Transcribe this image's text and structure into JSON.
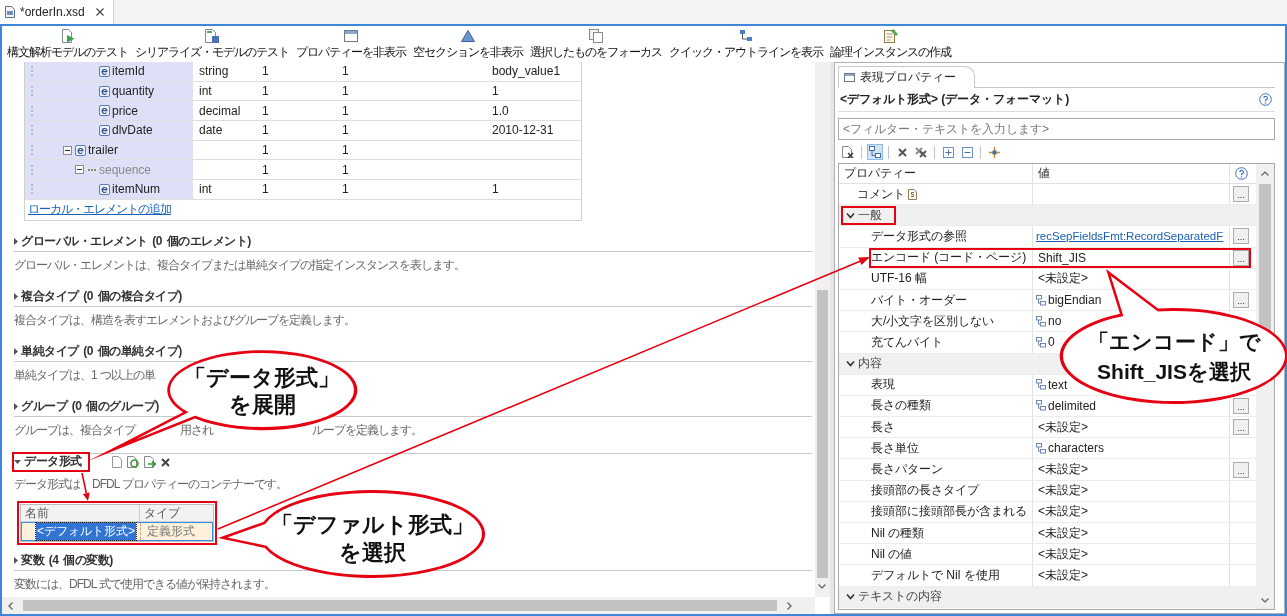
{
  "editor_tab": {
    "title": "*orderIn.xsd",
    "selected": true
  },
  "toolbar": [
    {
      "kind": "parse_test",
      "label": "構文解析モデルのテスト"
    },
    {
      "kind": "serialize_test",
      "label": "シリアライズ・モデルのテスト"
    },
    {
      "kind": "hide_properties",
      "label": "プロパティーを非表示"
    },
    {
      "kind": "hide_empty",
      "label": "空セクションを非表示"
    },
    {
      "kind": "focus",
      "label": "選択したものをフォーカス"
    },
    {
      "kind": "outline",
      "label": "クイック・アウトラインを表示"
    },
    {
      "kind": "create_instance",
      "label": "論理インスタンスの作成"
    }
  ],
  "element_table": {
    "continued_rows": [
      {
        "kind": "element",
        "name": "itemId",
        "column_2": "string",
        "column_3": "1",
        "column_4": "1",
        "column_5": "body_value1"
      },
      {
        "kind": "element",
        "name": "quantity",
        "column_2": "int",
        "column_3": "1",
        "column_4": "1",
        "column_5": "1"
      },
      {
        "kind": "element",
        "name": "price",
        "column_2": "decimal",
        "column_3": "1",
        "column_4": "1",
        "column_5": "1.0"
      },
      {
        "kind": "element",
        "name": "dlvDate",
        "column_2": "date",
        "column_3": "1",
        "column_4": "1",
        "column_5": "2010-12-31"
      }
    ],
    "rows": [
      {
        "kind": "element",
        "name": "trailer",
        "expanded": true,
        "column_3": "1",
        "column_4": "1",
        "children": [
          {
            "kind": "sequence",
            "name": "sequence",
            "expanded": true,
            "column_3": "1",
            "column_4": "1",
            "children": [
              {
                "kind": "element",
                "name": "itemNum",
                "column_2": "int",
                "column_3": "1",
                "column_4": "1",
                "column_5": "1"
              }
            ]
          }
        ]
      }
    ],
    "add_link": "ローカル・エレメントの追加"
  },
  "sections": [
    {
      "title": "グローバル・エレメント (0 個のエレメント)",
      "expanded": false,
      "highlighted": false,
      "description": "グローバル・エレメントは、複合タイプまたは単純タイプの指定インスタンスを表します。"
    },
    {
      "title": "複合タイプ (0 個の複合タイプ)",
      "expanded": false,
      "highlighted": false,
      "description": "複合タイプは、構造を表すエレメントおよびグループを定義します。"
    },
    {
      "title": "単純タイプ (0 個の単純タイプ)",
      "expanded": false,
      "highlighted": false,
      "description_parts": [
        "単純タイプは、1 つ以上の単"
      ]
    },
    {
      "title": "グループ (0 個のグループ)",
      "expanded": false,
      "highlighted": false,
      "description_parts": [
        "グループは、複合タイプ",
        "用され",
        "ループを定義します。"
      ]
    },
    {
      "title": "データ形式",
      "expanded": true,
      "highlighted": true,
      "tools": [
        {
          "kind": "new"
        },
        {
          "kind": "refresh"
        },
        {
          "kind": "import"
        },
        {
          "kind": "delete"
        }
      ],
      "description_parts": [
        "データ形式は",
        "DFDL プロパティーのコンテナーです。"
      ],
      "table": {
        "highlighted": true,
        "columns": [
          "名前",
          "タイプ"
        ],
        "rows": [
          {
            "cells": [
              "<デフォルト形式>",
              "定義形式"
            ],
            "selected": true
          }
        ]
      }
    },
    {
      "title": "変数 (4 個の変数)",
      "expanded": false,
      "highlighted": false,
      "description": "変数には、DFDL 式で使用できる値が保持されます。"
    }
  ],
  "properties_view": {
    "tab": {
      "title": "表現プロパティー",
      "selected": true
    },
    "heading": "<デフォルト形式> (データ・フォーマット)",
    "filter": {
      "placeholder": "<フィルター・テキストを入力します>"
    },
    "tool_groups": [
      [
        {
          "kind": "document",
          "pressed": false
        }
      ],
      [
        {
          "kind": "tree",
          "pressed": true
        }
      ],
      [
        {
          "kind": "delete",
          "pressed": false
        },
        {
          "kind": "delete_all",
          "pressed": false
        }
      ],
      [
        {
          "kind": "expand_all",
          "pressed": false
        },
        {
          "kind": "collapse_all",
          "pressed": false
        }
      ],
      [
        {
          "kind": "pin",
          "pressed": false
        }
      ]
    ],
    "columns": [
      "プロパティー",
      "値"
    ],
    "rows": [
      {
        "kind": "comment",
        "name": "コメント",
        "button": "...",
        "highlighted": false
      },
      {
        "kind": "category",
        "name": "一般",
        "expanded": true,
        "highlighted": true,
        "children": [
          {
            "kind": "property",
            "name": "データ形式の参照",
            "value": {
              "kind": "link",
              "text": "recSepFieldsFmt:RecordSeparatedF"
            },
            "button": "...",
            "highlighted": false
          },
          {
            "kind": "property",
            "name": "エンコード (コード・ページ)",
            "value": {
              "kind": "plain",
              "text": "Shift_JIS"
            },
            "button": "...",
            "highlighted": true
          },
          {
            "kind": "property",
            "name": "UTF-16 幅",
            "value": {
              "kind": "plain",
              "text": "<未設定>"
            },
            "highlighted": false
          },
          {
            "kind": "property",
            "name": "バイト・オーダー",
            "value": {
              "kind": "choice",
              "text": "bigEndian"
            },
            "button": "...",
            "highlighted": false
          },
          {
            "kind": "property",
            "name": "大/小文字を区別しない",
            "value": {
              "kind": "choice",
              "text": "no"
            },
            "highlighted": false
          },
          {
            "kind": "property",
            "name": "充てんバイト",
            "value": {
              "kind": "choice",
              "text": "0"
            },
            "highlighted": false
          }
        ]
      },
      {
        "kind": "category",
        "name": "内容",
        "expanded": true,
        "highlighted": false,
        "children": [
          {
            "kind": "property",
            "name": "表現",
            "value": {
              "kind": "choice",
              "text": "text"
            },
            "highlighted": false
          },
          {
            "kind": "property",
            "name": "長さの種類",
            "value": {
              "kind": "choice",
              "text": "delimited"
            },
            "button": "...",
            "highlighted": false
          },
          {
            "kind": "property",
            "name": "長さ",
            "value": {
              "kind": "plain",
              "text": "<未設定>"
            },
            "button": "...",
            "highlighted": false
          },
          {
            "kind": "property",
            "name": "長さ単位",
            "value": {
              "kind": "choice",
              "text": "characters"
            },
            "highlighted": false
          },
          {
            "kind": "property",
            "name": "長さパターン",
            "value": {
              "kind": "plain",
              "text": "<未設定>"
            },
            "button": "...",
            "highlighted": false
          },
          {
            "kind": "property",
            "name": "接頭部の長さタイプ",
            "value": {
              "kind": "plain",
              "text": "<未設定>"
            },
            "highlighted": false
          },
          {
            "kind": "property",
            "name": "接頭部に接頭部長が含まれる",
            "value": {
              "kind": "plain",
              "text": "<未設定>"
            },
            "highlighted": false
          },
          {
            "kind": "property",
            "name": "Nil の種類",
            "value": {
              "kind": "plain",
              "text": "<未設定>"
            },
            "highlighted": false
          },
          {
            "kind": "property",
            "name": "Nil の値",
            "value": {
              "kind": "plain",
              "text": "<未設定>"
            },
            "highlighted": false
          },
          {
            "kind": "property",
            "name": "デフォルトで Nil を使用",
            "value": {
              "kind": "plain",
              "text": "<未設定>"
            },
            "highlighted": false
          }
        ]
      },
      {
        "kind": "category",
        "name": "テキストの内容",
        "expanded": true,
        "highlighted": false
      }
    ]
  },
  "callouts": [
    {
      "lines": [
        "「データ形式」",
        "を展開"
      ]
    },
    {
      "lines": [
        "「デファルト形式」",
        "を選択"
      ]
    },
    {
      "lines": [
        "「エンコード」で",
        "Shift_JISを選択"
      ]
    }
  ]
}
